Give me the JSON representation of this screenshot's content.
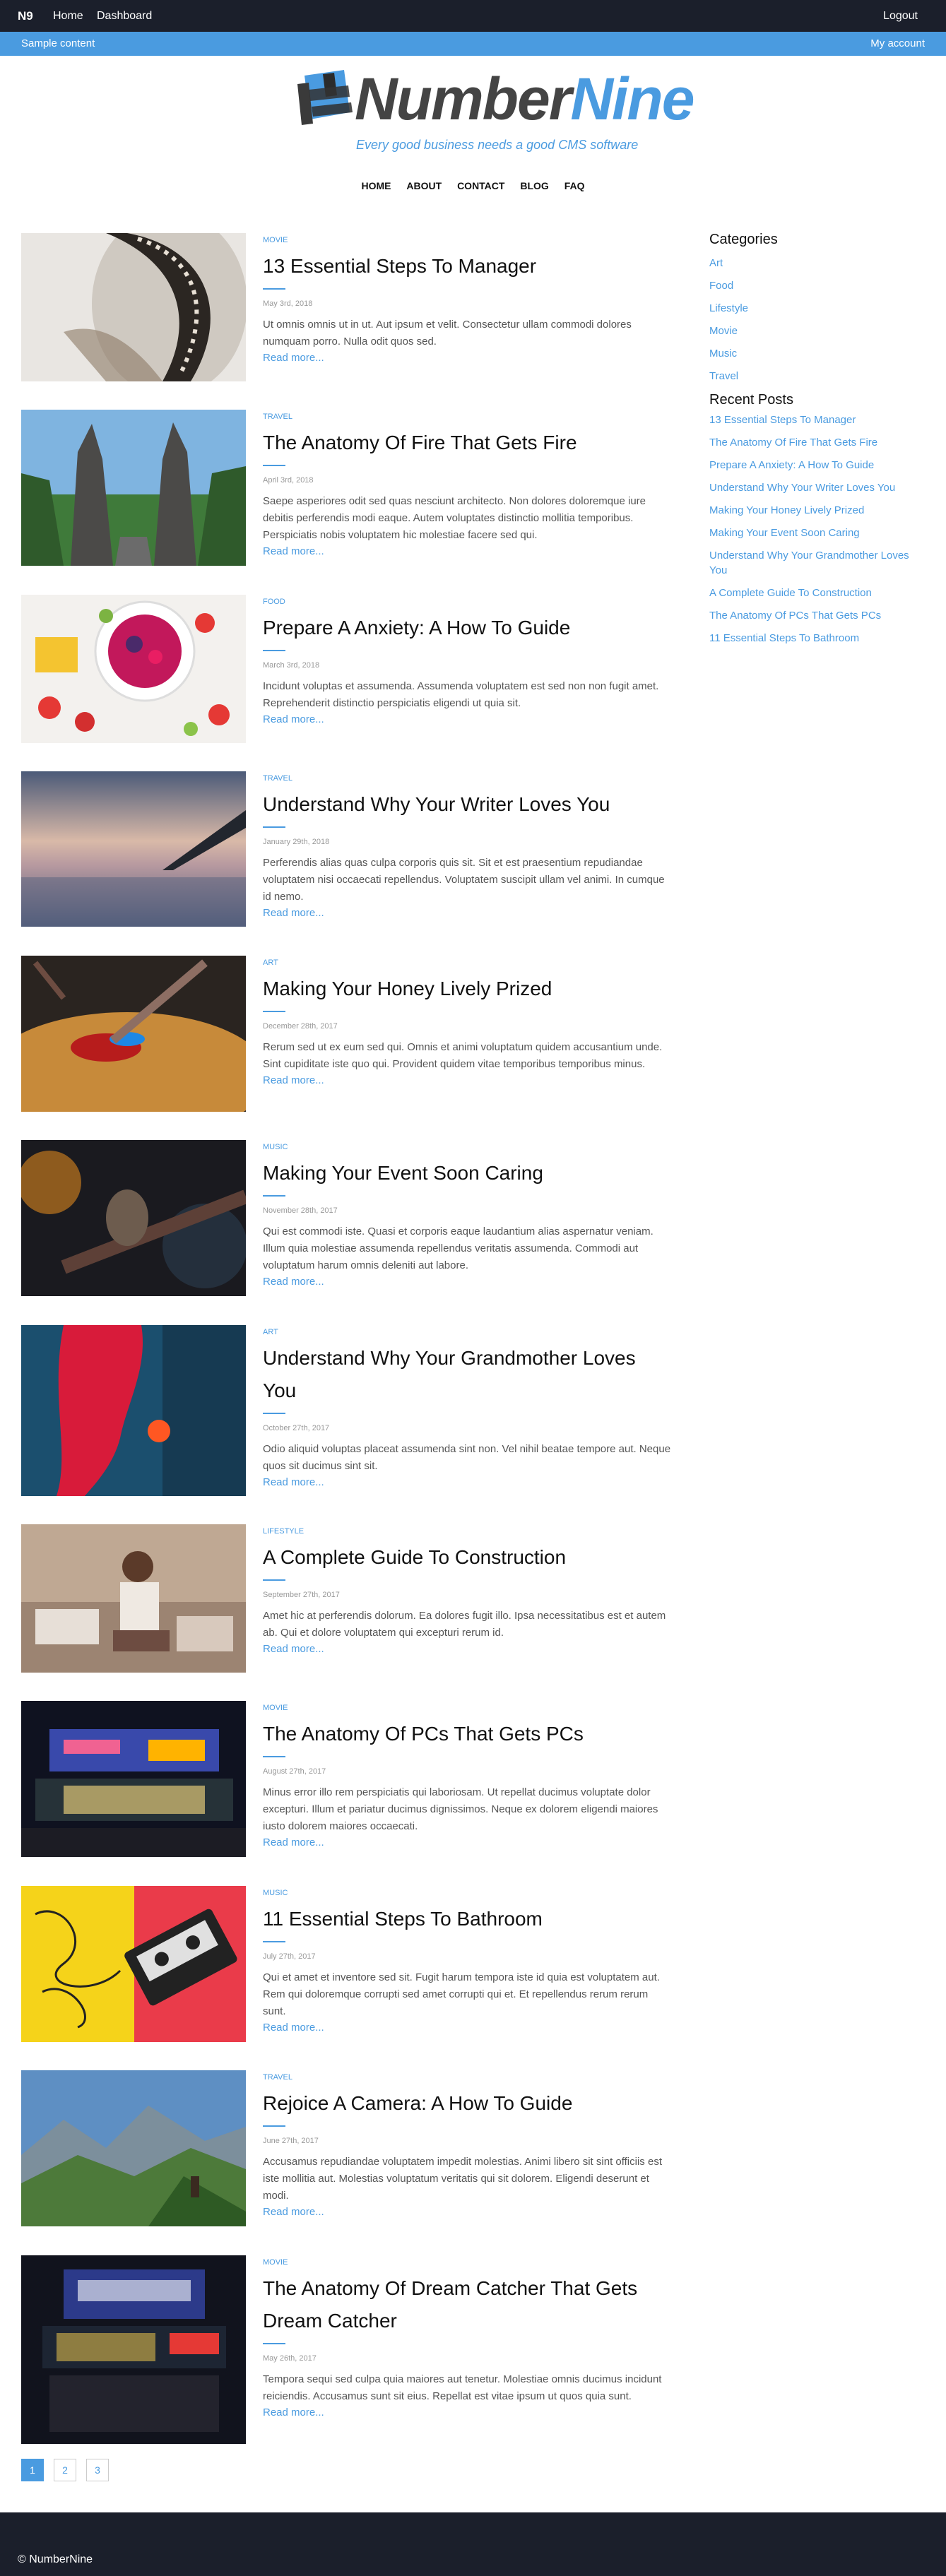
{
  "topnav": {
    "brand": "N9",
    "links": [
      "Home",
      "Dashboard"
    ],
    "logout": "Logout"
  },
  "subbar": {
    "left": "Sample content",
    "right": "My account"
  },
  "logo": {
    "word_part1": "Number",
    "word_part2": "Nine",
    "tagline": "Every good business needs a good CMS software"
  },
  "menu": [
    "HOME",
    "ABOUT",
    "CONTACT",
    "BLOG",
    "FAQ"
  ],
  "posts": [
    {
      "category": "MOVIE",
      "title": "13 Essential Steps To Manager",
      "date": "May 3rd, 2018",
      "excerpt": "Ut omnis omnis ut in ut. Aut ipsum et velit. Consectetur ullam commodi dolores numquam porro. Nulla odit quos sed.",
      "more": "Read more..."
    },
    {
      "category": "TRAVEL",
      "title": "The Anatomy Of Fire That Gets Fire",
      "date": "April 3rd, 2018",
      "excerpt": "Saepe asperiores odit sed quas nesciunt architecto. Non dolores doloremque iure debitis perferendis modi eaque. Autem voluptates distinctio mollitia temporibus. Perspiciatis nobis voluptatem hic molestiae facere sed qui.",
      "more": "Read more..."
    },
    {
      "category": "FOOD",
      "title": "Prepare A Anxiety: A How To Guide",
      "date": "March 3rd, 2018",
      "excerpt": "Incidunt voluptas et assumenda. Assumenda voluptatem est sed non non fugit amet. Reprehenderit distinctio perspiciatis eligendi ut quia sit.",
      "more": "Read more..."
    },
    {
      "category": "TRAVEL",
      "title": "Understand Why Your Writer Loves You",
      "date": "January 29th, 2018",
      "excerpt": "Perferendis alias quas culpa corporis quis sit. Sit et est praesentium repudiandae voluptatem nisi occaecati repellendus. Voluptatem suscipit ullam vel animi. In cumque id nemo.",
      "more": "Read more..."
    },
    {
      "category": "ART",
      "title": "Making Your Honey Lively Prized",
      "date": "December 28th, 2017",
      "excerpt": "Rerum sed ut ex eum sed qui. Omnis et animi voluptatum quidem accusantium unde. Sint cupiditate iste quo qui. Provident quidem vitae temporibus temporibus minus.",
      "more": "Read more..."
    },
    {
      "category": "MUSIC",
      "title": "Making Your Event Soon Caring",
      "date": "November 28th, 2017",
      "excerpt": "Qui est commodi iste. Quasi et corporis eaque laudantium alias aspernatur veniam. Illum quia molestiae assumenda repellendus veritatis assumenda. Commodi aut voluptatum harum omnis deleniti aut labore.",
      "more": "Read more..."
    },
    {
      "category": "ART",
      "title": "Understand Why Your Grandmother Loves You",
      "date": "October 27th, 2017",
      "excerpt": "Odio aliquid voluptas placeat assumenda sint non. Vel nihil beatae tempore aut. Neque quos sit ducimus sint sit.",
      "more": "Read more..."
    },
    {
      "category": "LIFESTYLE",
      "title": "A Complete Guide To Construction",
      "date": "September 27th, 2017",
      "excerpt": "Amet hic at perferendis dolorum. Ea dolores fugit illo. Ipsa necessitatibus est et autem ab. Qui et dolore voluptatem qui excepturi rerum id.",
      "more": "Read more..."
    },
    {
      "category": "MOVIE",
      "title": "The Anatomy Of PCs That Gets PCs",
      "date": "August 27th, 2017",
      "excerpt": "Minus error illo rem perspiciatis qui laboriosam. Ut repellat ducimus voluptate dolor excepturi. Illum et pariatur ducimus dignissimos. Neque ex dolorem eligendi maiores iusto dolorem maiores occaecati.",
      "more": "Read more..."
    },
    {
      "category": "MUSIC",
      "title": "11 Essential Steps To Bathroom",
      "date": "July 27th, 2017",
      "excerpt": "Qui et amet et inventore sed sit. Fugit harum tempora iste id quia est voluptatem aut. Rem qui doloremque corrupti sed amet corrupti qui et. Et repellendus rerum rerum sunt.",
      "more": "Read more..."
    },
    {
      "category": "TRAVEL",
      "title": "Rejoice A Camera: A How To Guide",
      "date": "June 27th, 2017",
      "excerpt": "Accusamus repudiandae voluptatem impedit molestias. Animi libero sit sint officiis est iste mollitia aut. Molestias voluptatum veritatis qui sit dolorem. Eligendi deserunt et modi.",
      "more": "Read more..."
    },
    {
      "category": "MOVIE",
      "title": "The Anatomy Of Dream Catcher That Gets Dream Catcher",
      "date": "May 26th, 2017",
      "excerpt": "Tempora sequi sed culpa quia maiores aut tenetur. Molestiae omnis ducimus incidunt reiciendis. Accusamus sunt sit eius. Repellat est vitae ipsum ut quos quia sunt.",
      "more": "Read more..."
    }
  ],
  "sidebar": {
    "categories_title": "Categories",
    "categories": [
      "Art",
      "Food",
      "Lifestyle",
      "Movie",
      "Music",
      "Travel"
    ],
    "recent_title": "Recent Posts",
    "recent": [
      "13 Essential Steps To Manager",
      "The Anatomy Of Fire That Gets Fire",
      "Prepare A Anxiety: A How To Guide",
      "Understand Why Your Writer Loves You",
      "Making Your Honey Lively Prized",
      "Making Your Event Soon Caring",
      "Understand Why Your Grandmother Loves You",
      "A Complete Guide To Construction",
      "The Anatomy Of PCs That Gets PCs",
      "11 Essential Steps To Bathroom"
    ]
  },
  "pagination": {
    "pages": [
      "1",
      "2",
      "3"
    ],
    "current": "1"
  },
  "footer": {
    "copyright": "© NumberNine"
  },
  "colors": {
    "accent": "#4a9be0",
    "nav_bg": "#1b1f2b"
  }
}
